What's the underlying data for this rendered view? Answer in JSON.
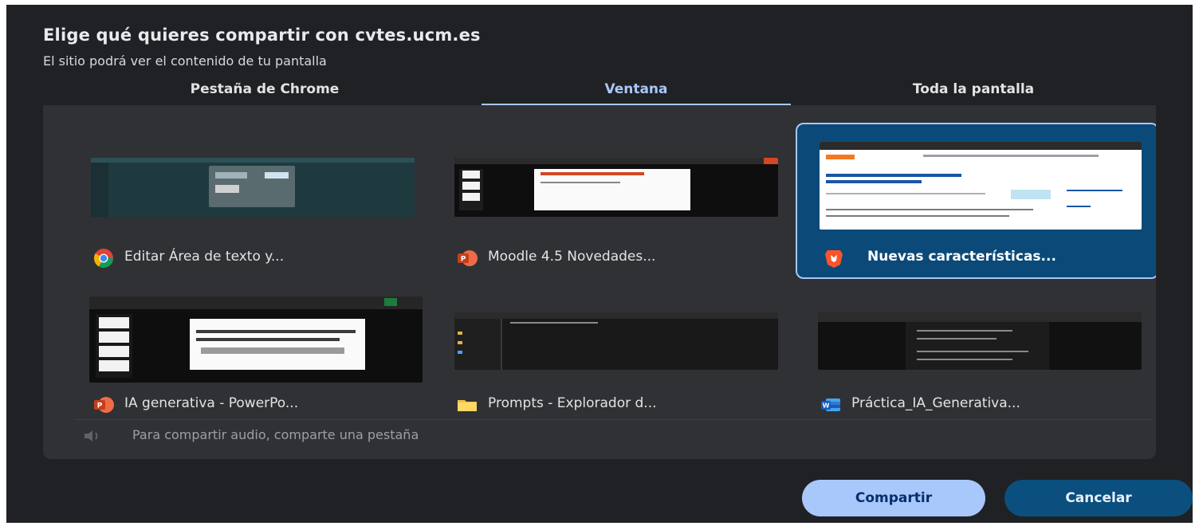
{
  "dialog": {
    "title": "Elige qué quieres compartir con cvtes.ucm.es",
    "subtitle": "El sitio podrá ver el contenido de tu pantalla"
  },
  "tabs": [
    {
      "label": "Pestaña de Chrome",
      "selected": false
    },
    {
      "label": "Ventana",
      "selected": true
    },
    {
      "label": "Toda la pantalla",
      "selected": false
    }
  ],
  "windows": [
    {
      "label": "Editar Área de texto y...",
      "icon": "chrome-icon",
      "selected": false
    },
    {
      "label": "Moodle 4.5 Novedades...",
      "icon": "powerpoint-icon",
      "selected": false
    },
    {
      "label": "Nuevas características...",
      "icon": "brave-icon",
      "selected": true
    },
    {
      "label": "IA generativa - PowerPo...",
      "icon": "powerpoint-icon",
      "selected": false
    },
    {
      "label": "Prompts - Explorador d...",
      "icon": "folder-icon",
      "selected": false
    },
    {
      "label": "Práctica_IA_Generativa...",
      "icon": "word-icon",
      "selected": false
    }
  ],
  "audio": {
    "text": "Para compartir audio, comparte una pestaña",
    "icon": "speaker-muted-icon"
  },
  "buttons": {
    "share": "Compartir",
    "cancel": "Cancelar"
  },
  "colors": {
    "dialog_bg": "#202124",
    "panel_bg": "#303135",
    "accent": "#a8c7fa",
    "selected_card": "#0b4a78",
    "cancel_button": "#0b4f7e"
  }
}
